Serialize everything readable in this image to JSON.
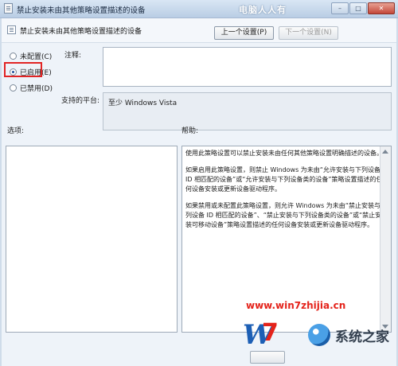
{
  "window": {
    "title": "禁止安装未由其他策略设置描述的设备",
    "watermark_top": "电脑人人有",
    "controls": {
      "minimize": "–",
      "maximize": "□",
      "close": "✕"
    }
  },
  "header": {
    "policy_title": "禁止安装未由其他策略设置描述的设备",
    "prev_button": "上一个设置(P)",
    "next_button": "下一个设置(N)"
  },
  "state": {
    "options": [
      {
        "label": "未配置(C)",
        "checked": false
      },
      {
        "label": "已启用(E)",
        "checked": true
      },
      {
        "label": "已禁用(D)",
        "checked": false
      }
    ]
  },
  "fields": {
    "comment_label": "注释:",
    "comment_value": "",
    "platform_label": "支持的平台:",
    "platform_value": "至少 Windows Vista"
  },
  "panes": {
    "options_label": "选项:",
    "help_label": "帮助:",
    "help_paragraphs": [
      "使用此策略设置可以禁止安装未由任何其他策略设置明确描述的设备。",
      "如果启用此策略设置，则禁止 Windows 为未由“允许安装与下列设备 ID 相匹配的设备”或“允许安装与下列设备类的设备”策略设置描述的任何设备安装或更新设备驱动程序。",
      "如果禁用或未配置此策略设置，则允许 Windows 为未由“禁止安装与下列设备 ID 相匹配的设备”、“禁止安装与下列设备类的设备”或“禁止安装可移动设备”策略设置描述的任何设备安装或更新设备驱动程序。"
    ]
  },
  "watermark": {
    "url": "www.win7zhijia.cn",
    "site_name": "系统之家",
    "logo_letters": "W",
    "logo_number": "7"
  },
  "colors": {
    "highlight_box": "#e12424",
    "title_bar": "#c9d8ea",
    "radio_dot": "#1e4f9c"
  }
}
